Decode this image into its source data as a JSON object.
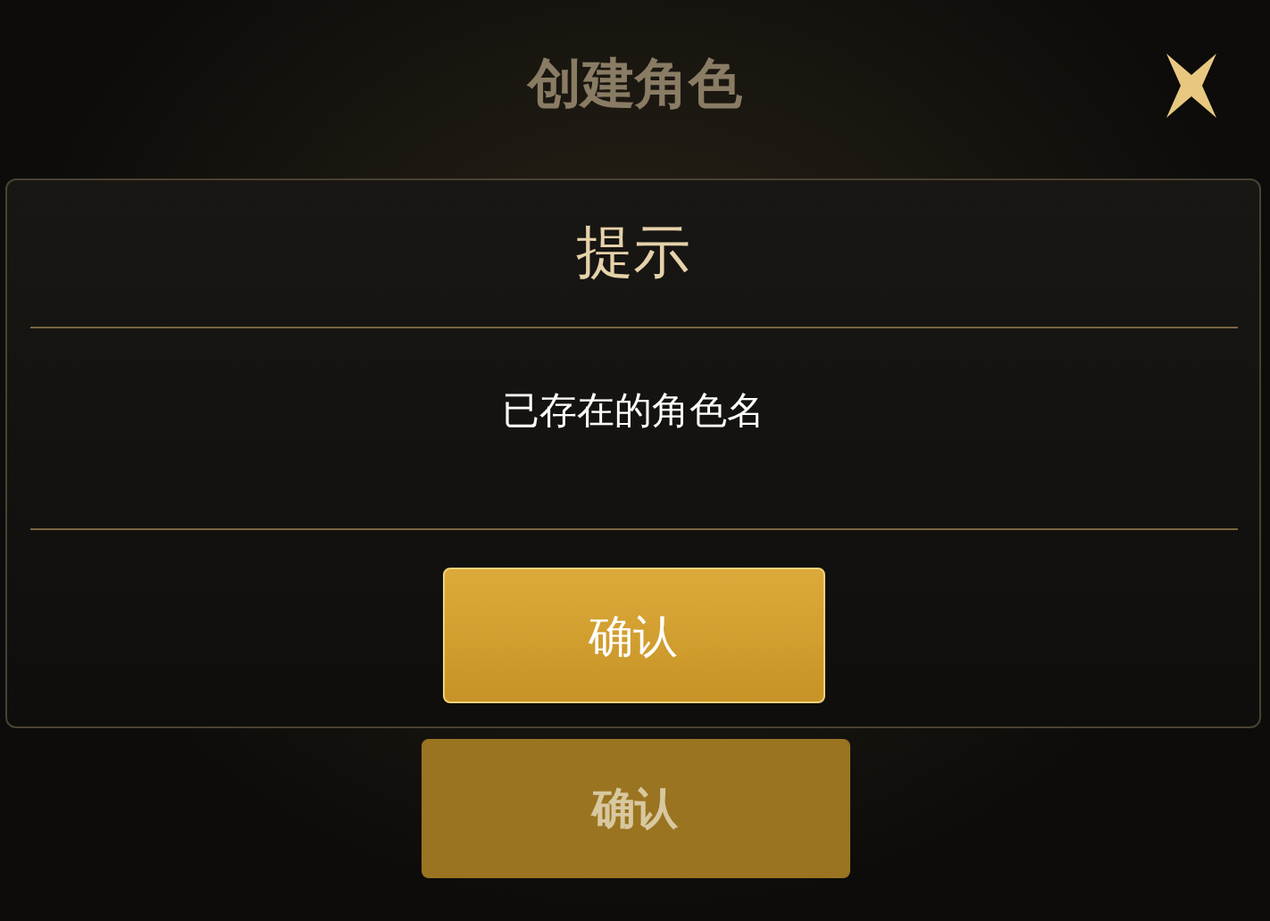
{
  "background": {
    "title": "创建角色",
    "button": "确认"
  },
  "dialog": {
    "title": "提示",
    "message": "已存在的角色名",
    "button": "确认"
  }
}
